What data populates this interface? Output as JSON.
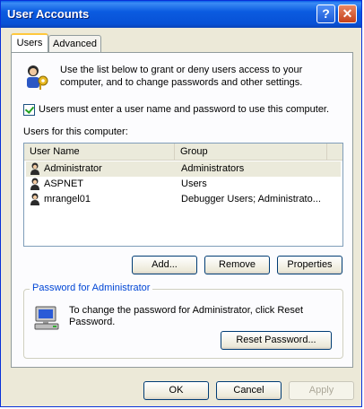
{
  "window": {
    "title": "User Accounts"
  },
  "titlebar": {
    "help_glyph": "?",
    "close_glyph": "✕"
  },
  "tabs": [
    {
      "label": "Users"
    },
    {
      "label": "Advanced"
    }
  ],
  "intro": {
    "text": "Use the list below to grant or deny users access to your computer, and to change passwords and other settings."
  },
  "checkbox": {
    "label": "Users must enter a user name and password to use this computer.",
    "checked": true
  },
  "users_list": {
    "label": "Users for this computer:",
    "columns": [
      "User Name",
      "Group"
    ],
    "rows": [
      {
        "name": "Administrator",
        "group": "Administrators"
      },
      {
        "name": "ASPNET",
        "group": "Users"
      },
      {
        "name": "mrangel01",
        "group": "Debugger Users; Administrato..."
      }
    ]
  },
  "list_buttons": {
    "add": "Add...",
    "remove": "Remove",
    "properties": "Properties"
  },
  "password_group": {
    "title": "Password for Administrator",
    "text": "To change the password for Administrator, click Reset Password.",
    "reset_button": "Reset Password..."
  },
  "dialog_buttons": {
    "ok": "OK",
    "cancel": "Cancel",
    "apply": "Apply"
  },
  "icons": {
    "users": "users-keys-icon",
    "user": "user-icon",
    "computer": "computer-icon"
  },
  "colors": {
    "titlebar": "#0a5fe8",
    "group_title": "#0046d5",
    "selected_row": "#ebeadb"
  }
}
